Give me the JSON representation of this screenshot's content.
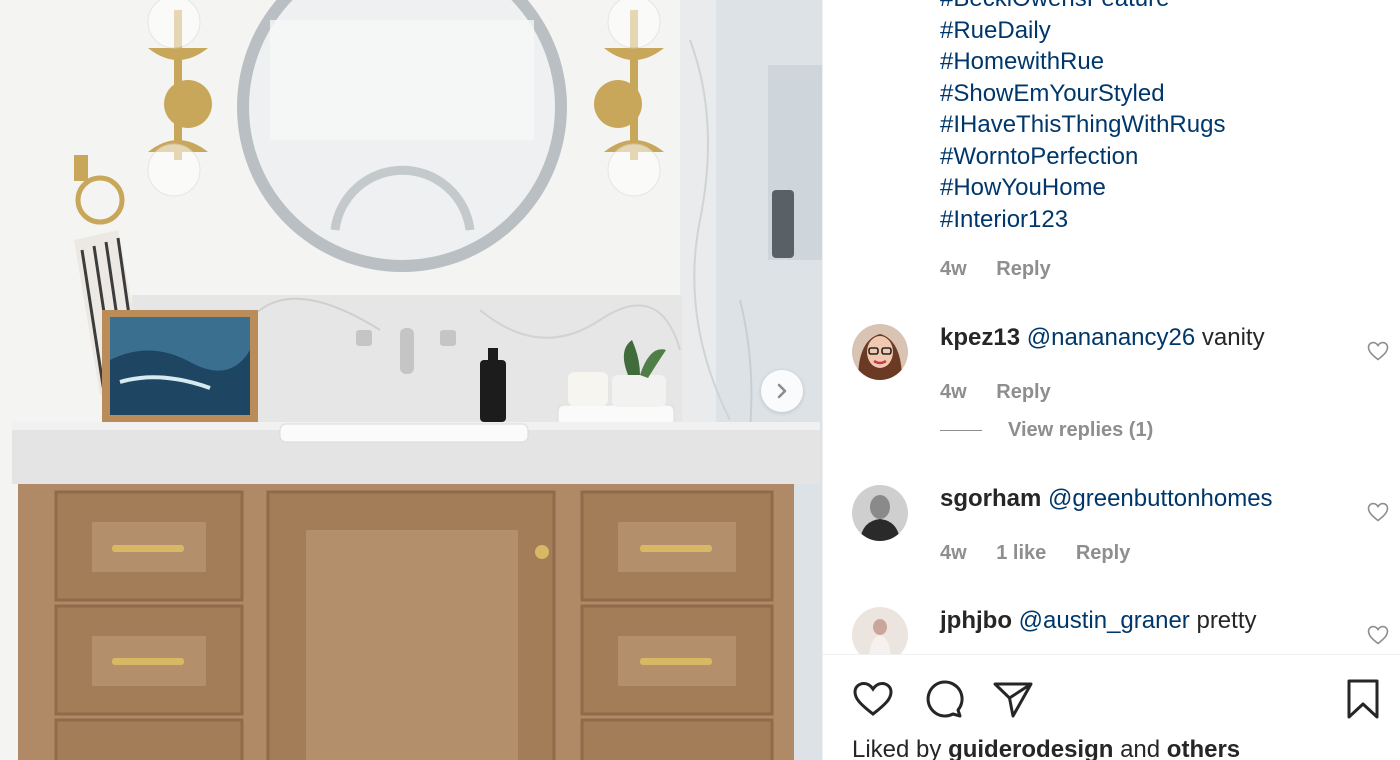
{
  "post": {
    "next_icon": "chevron-right-icon"
  },
  "caption": {
    "hashtags": [
      "#BeckiOwensFeature",
      "#RueDaily",
      "#HomewithRue",
      "#ShowEmYourStyled",
      "#IHaveThisThingWithRugs",
      "#WorntoPerfection",
      "#HowYouHome",
      "#Interior123"
    ],
    "age": "4w",
    "reply": "Reply"
  },
  "comments": [
    {
      "username": "kpez13",
      "mention": "@nananancy26",
      "text": " vanity",
      "age": "4w",
      "reply": "Reply",
      "view_replies": "View replies (1)"
    },
    {
      "username": "sgorham",
      "mention": "@greenbuttonhomes",
      "text": "",
      "age": "4w",
      "likes": "1 like",
      "reply": "Reply"
    },
    {
      "username": "jphjbo",
      "mention": "@austin_graner",
      "text": " pretty"
    }
  ],
  "actions": {
    "like_icon": "heart-icon",
    "comment_icon": "comment-icon",
    "share_icon": "paper-plane-icon",
    "save_icon": "bookmark-icon"
  },
  "likes_summary": {
    "prefix": "Liked by ",
    "user": "guiderodesign",
    "middle": " and ",
    "others": "others"
  },
  "colors": {
    "link": "#00376b",
    "muted": "#8e8e8e",
    "text": "#262626"
  }
}
